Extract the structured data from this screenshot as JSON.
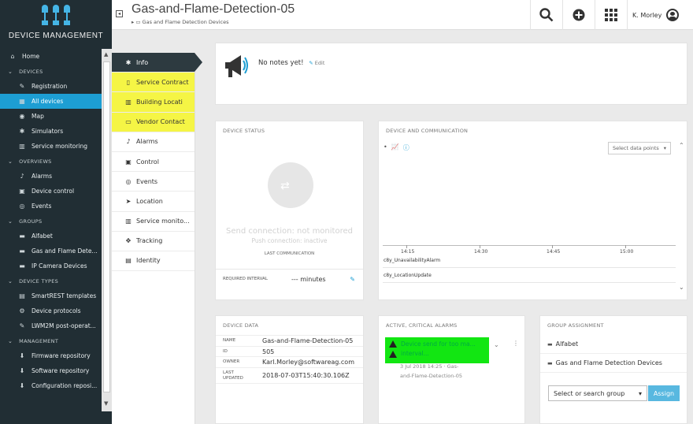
{
  "app": {
    "title": "DEVICE MANAGEMENT",
    "colors": {
      "nav_bg": "#212e34",
      "accent": "#1d9ed3",
      "highlight": "#f5f545",
      "alarm": "#12e612"
    }
  },
  "nav": {
    "home": "Home",
    "sections": [
      {
        "label": "DEVICES",
        "items": [
          "Registration",
          "All devices",
          "Map",
          "Simulators",
          "Service monitoring"
        ]
      },
      {
        "label": "OVERVIEWS",
        "items": [
          "Alarms",
          "Device control",
          "Events"
        ]
      },
      {
        "label": "GROUPS",
        "items": [
          "Alfabet",
          "Gas and Flame Dete...",
          "IP Camera Devices"
        ]
      },
      {
        "label": "DEVICE TYPES",
        "items": [
          "SmartREST templates",
          "Device protocols",
          "LWM2M post-operat..."
        ]
      },
      {
        "label": "MANAGEMENT",
        "items": [
          "Firmware repository",
          "Software repository",
          "Configuration reposi..."
        ]
      }
    ]
  },
  "header": {
    "title": "Gas-and-Flame-Detection-05",
    "breadcrumb": "Gas and Flame Detection Devices",
    "user": "K. Morley"
  },
  "tabs": [
    "Info",
    "Service Contract",
    "Building Locati",
    "Vendor Contact",
    "Alarms",
    "Control",
    "Events",
    "Location",
    "Service monito...",
    "Tracking",
    "Identity"
  ],
  "notes": {
    "text": "No notes yet!",
    "edit": "Edit"
  },
  "device_status": {
    "title": "DEVICE STATUS",
    "send_connection": "Send connection: not monitored",
    "push_connection": "Push connection: inactive",
    "last_communication": "LAST COMMUNICATION",
    "required_interval_label": "REQUIRED INTERVAL",
    "required_interval_value": "--- minutes"
  },
  "device_comm": {
    "title": "DEVICE AND COMMUNICATION",
    "select_placeholder": "Select data points",
    "ticks": [
      "14:15",
      "14:30",
      "14:45",
      "15:00"
    ],
    "events": [
      "c8y_UnavailabilityAlarm",
      "c8y_LocationUpdate"
    ]
  },
  "device_data": {
    "title": "DEVICE DATA",
    "name_label": "NAME",
    "name": "Gas-and-Flame-Detection-05",
    "id_label": "ID",
    "id": "505",
    "owner_label": "OWNER",
    "owner": "Karl.Morley@softwareag.com",
    "updated_label_1": "LAST",
    "updated_label_2": "UPDATED",
    "updated": "2018-07-03T15:40:30.106Z"
  },
  "alarms": {
    "title": "ACTIVE, CRITICAL ALARMS",
    "alarm_text_1": "Device send for too ma...",
    "alarm_text_2": "interval...",
    "meta_1": "3 Jul 2018 14:25 · Gas-",
    "meta_2": "and-Flame-Detection-05"
  },
  "groups": {
    "title": "GROUP ASSIGNMENT",
    "items": [
      "Alfabet",
      "Gas and Flame Detection Devices"
    ],
    "select_placeholder": "Select or search group",
    "assign": "Assign"
  }
}
